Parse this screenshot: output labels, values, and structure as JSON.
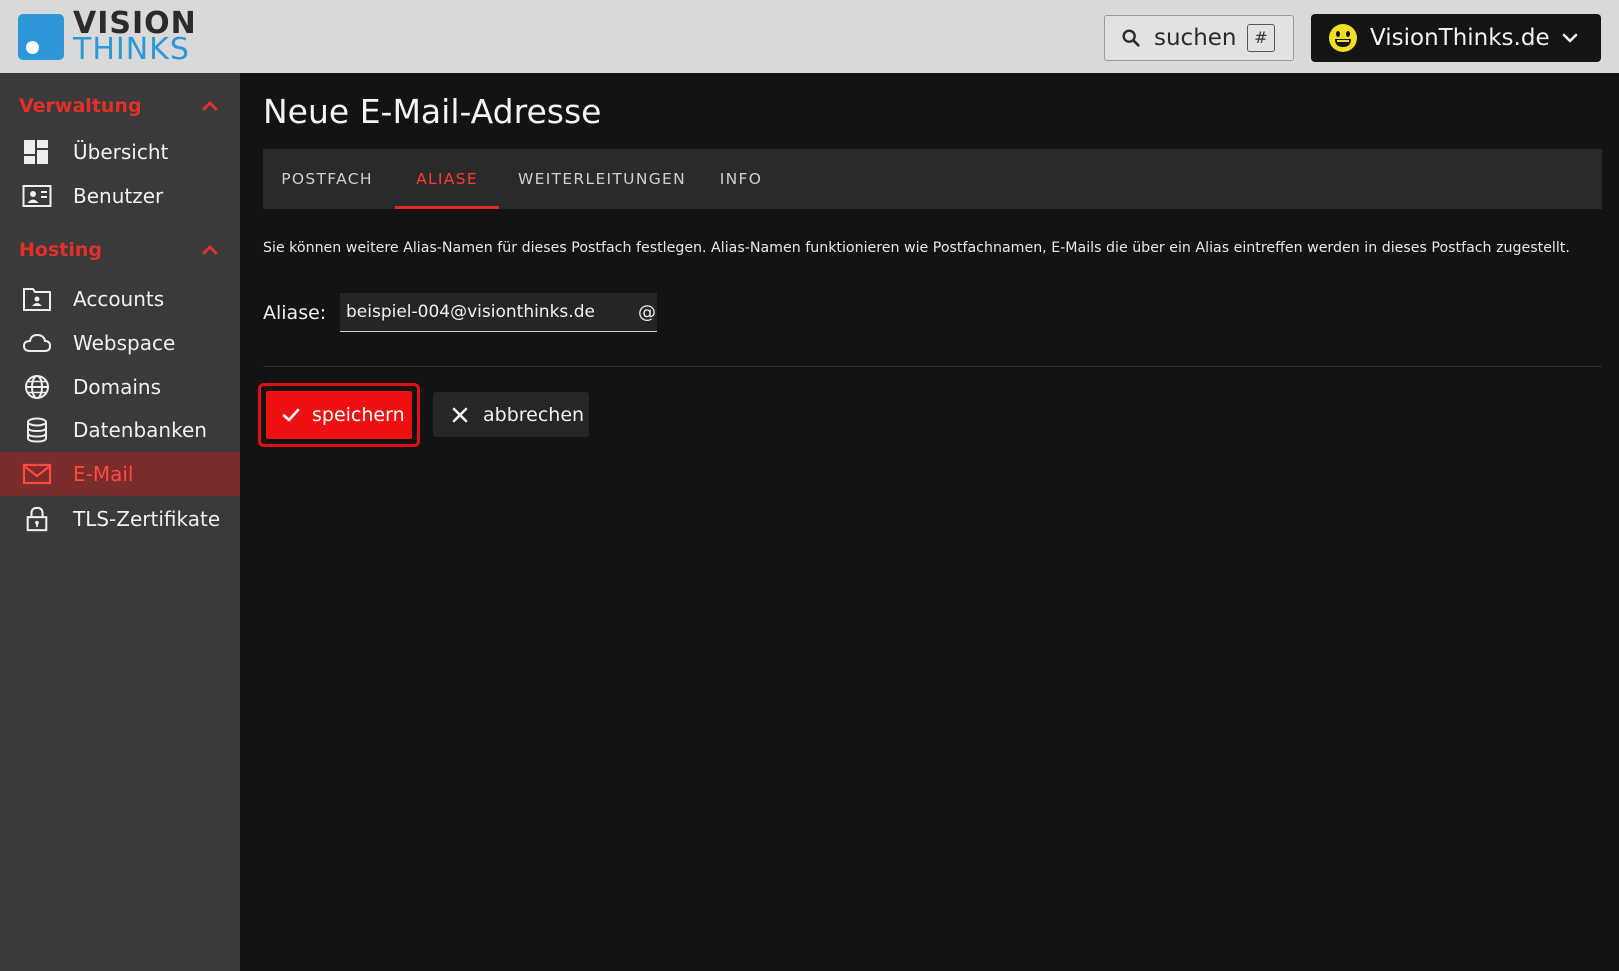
{
  "app": {
    "logo_line1": "VISION",
    "logo_line2": "THINKS",
    "brand_color": "#2e97d8",
    "accent_color": "#e5302a"
  },
  "header": {
    "search_label": "suchen",
    "search_shortcut": "#",
    "search_icon": "search-icon",
    "account_label": "VisionThinks.de",
    "account_icon": "smiley-icon"
  },
  "sidebar": {
    "sections": [
      {
        "label": "Verwaltung",
        "expanded": true
      },
      {
        "label": "Hosting",
        "expanded": true
      }
    ],
    "verwaltung_items": [
      {
        "label": "Übersicht",
        "icon": "dashboard-icon"
      },
      {
        "label": "Benutzer",
        "icon": "user-card-icon"
      }
    ],
    "hosting_items": [
      {
        "label": "Accounts",
        "icon": "account-folder-icon"
      },
      {
        "label": "Webspace",
        "icon": "cloud-icon"
      },
      {
        "label": "Domains",
        "icon": "globe-icon"
      },
      {
        "label": "Datenbanken",
        "icon": "database-icon"
      },
      {
        "label": "E-Mail",
        "icon": "mail-icon",
        "active": true
      },
      {
        "label": "TLS-Zertifikate",
        "icon": "lock-icon"
      }
    ]
  },
  "main": {
    "title": "Neue E-Mail-Adresse",
    "tabs": [
      {
        "label": "POSTFACH"
      },
      {
        "label": "ALIASE",
        "active": true
      },
      {
        "label": "WEITERLEITUNGEN"
      },
      {
        "label": "INFO"
      }
    ],
    "description": "Sie können weitere Alias-Namen für dieses Postfach festlegen. Alias-Namen funktionieren wie Postfachnamen, E-Mails die über ein Alias eintreffen werden in dieses Postfach zugestellt.",
    "alias_field": {
      "label": "Aliase:",
      "value": "beispiel-004@visionthinks.de",
      "suffix": "@"
    },
    "save_label": "speichern",
    "cancel_label": "abbrechen"
  }
}
